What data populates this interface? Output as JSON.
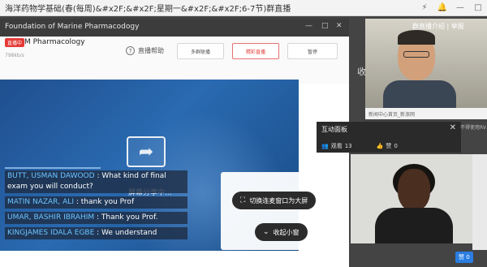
{
  "window": {
    "title": "海洋药物学基础(春(每周)&#x2F;&#x2F;星期一&#x2F;&#x2F;6-7节)群直播",
    "controls": [
      "⚡",
      "🔔",
      "—",
      "□"
    ]
  },
  "inner": {
    "title": "Foundation of Marine Pharmacodogy",
    "live_badge": "直播中",
    "course_name": "M    Pharmacology",
    "speed": "798kb/s",
    "help_label": "直播帮助",
    "toolbar_buttons": [
      "多群联播",
      "精彩直播",
      "暂停"
    ]
  },
  "screen": {
    "share_label": "屏幕分享中..."
  },
  "chat": [
    {
      "name": "BUTT, USMAN DAWOOD",
      "text": " : What kind of final exam you will conduct?"
    },
    {
      "name": "MATIN NAZAR, ALI",
      "text": " : thank you Prof"
    },
    {
      "name": "UMAR, BASHIR IBRAHIM",
      "text": " : Thank you Prof."
    },
    {
      "name": "KINGJAMES IDALA EGBE",
      "text": " : We understand"
    }
  ],
  "popup": {
    "switch_label": "切换连麦窗口为大屏",
    "collapse_label": "收起小窗"
  },
  "teacher": {
    "links": "群直播介绍 | 举报",
    "caption": "新闻中心首页_新浪网",
    "side_text": "收"
  },
  "panel": {
    "title": "互动面板",
    "close": "✕",
    "viewers_label": "观看",
    "viewers": "13",
    "likes_label": "赞",
    "likes": "0",
    "side_note": "不得使用RV"
  },
  "like_badge": "赞 0"
}
